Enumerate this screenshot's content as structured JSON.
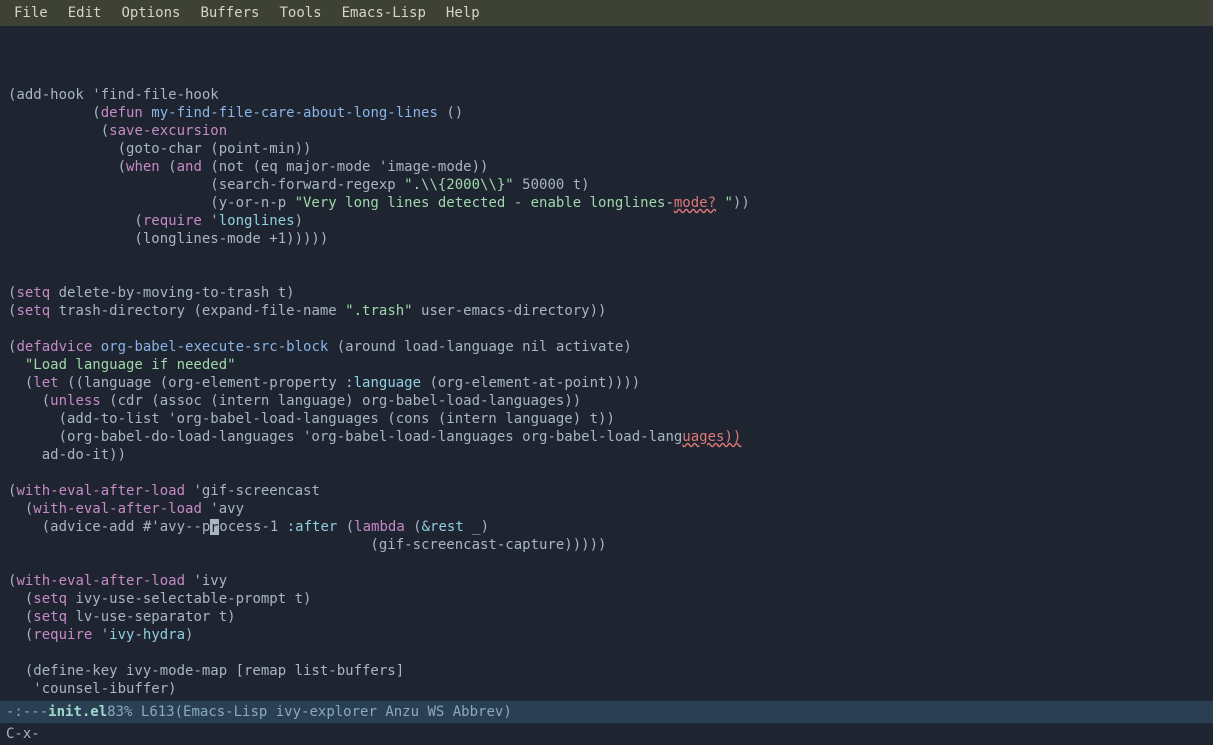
{
  "menubar": {
    "items": [
      "File",
      "Edit",
      "Options",
      "Buffers",
      "Tools",
      "Emacs-Lisp",
      "Help"
    ]
  },
  "code": {
    "l1_a": "(add-hook 'find-file-hook",
    "l2_indent": "          (",
    "l2_kw": "defun",
    "l2_fn": " my-find-file-care-about-long-lines",
    "l2_rest": " ()",
    "l3_indent": "           (",
    "l3_kw": "save-excursion",
    "l4": "             (goto-char (point-min))",
    "l5_indent": "             (",
    "l5_kw": "when",
    "l5_a": " (",
    "l5_kw2": "and",
    "l5_b": " (not (eq major-mode 'image-mode))",
    "l6_a": "                        (search-forward-regexp ",
    "l6_str": "\".\\\\{2000\\\\}\"",
    "l6_b": " 50000 t)",
    "l7_a": "                        (y-or-n-p ",
    "l7_str": "\"Very long lines detected - enable longlines-",
    "l7_err": "mode?",
    "l7_str2": " \"",
    "l7_b": "))",
    "l8_indent": "               (",
    "l8_kw": "require",
    "l8_a": " '",
    "l8_sym": "longlines",
    "l8_b": ")",
    "l9": "               (longlines-mode +1)))))",
    "l11_a": "(",
    "l11_kw": "setq",
    "l11_b": " delete-by-moving-to-trash t)",
    "l12_a": "(",
    "l12_kw": "setq",
    "l12_b": " trash-directory (expand-file-name ",
    "l12_str": "\".trash\"",
    "l12_c": " user-emacs-directory))",
    "l14_a": "(",
    "l14_kw": "defadvice",
    "l14_fn": " org-babel-execute-src-block",
    "l14_b": " (around load-language nil activate)",
    "l15_str": "  \"Load language if needed\"",
    "l16_a": "  (",
    "l16_kw": "let",
    "l16_b": " ((language (org-element-property ",
    "l16_key": ":language",
    "l16_c": " (org-element-at-point))))",
    "l17_a": "    (",
    "l17_kw": "unless",
    "l17_b": " (cdr (assoc (intern language) org-babel-load-languages))",
    "l18": "      (add-to-list 'org-babel-load-languages (cons (intern language) t))",
    "l19_a": "      (org-babel-do-load-languages 'org-babel-load-languages org-babel-load-lang",
    "l19_err": "uages))",
    "l20": "    ad-do-it))",
    "l22_a": "(",
    "l22_kw": "with-eval-after-load",
    "l22_b": " 'gif-screencast",
    "l23_a": "  (",
    "l23_kw": "with-eval-after-load",
    "l23_b": " 'avy",
    "l24_a": "    (advice-add #'avy--p",
    "l24_cur": "r",
    "l24_b": "ocess-1 ",
    "l24_key": ":after",
    "l24_c": " (",
    "l24_kw": "lambda",
    "l24_d": " (",
    "l24_sym": "&rest",
    "l24_e": " _)",
    "l25": "                                           (gif-screencast-capture)))))",
    "l27_a": "(",
    "l27_kw": "with-eval-after-load",
    "l27_b": " 'ivy",
    "l28_a": "  (",
    "l28_kw": "setq",
    "l28_b": " ivy-use-selectable-prompt t)",
    "l29_a": "  (",
    "l29_kw": "setq",
    "l29_b": " lv-use-separator t)",
    "l30_a": "  (",
    "l30_kw": "require",
    "l30_b": " '",
    "l30_sym": "ivy-hydra",
    "l30_c": ")",
    "l32": "  (define-key ivy-mode-map [remap list-buffers]",
    "l33": "   'counsel-ibuffer)"
  },
  "modeline": {
    "prefix": "-:---  ",
    "file": "init.el",
    "spacer": "       ",
    "pos": "83% L613",
    "spacer2": "   ",
    "modes": "(Emacs-Lisp ivy-explorer Anzu WS Abbrev)"
  },
  "minibuffer": {
    "text": "C-x-"
  }
}
